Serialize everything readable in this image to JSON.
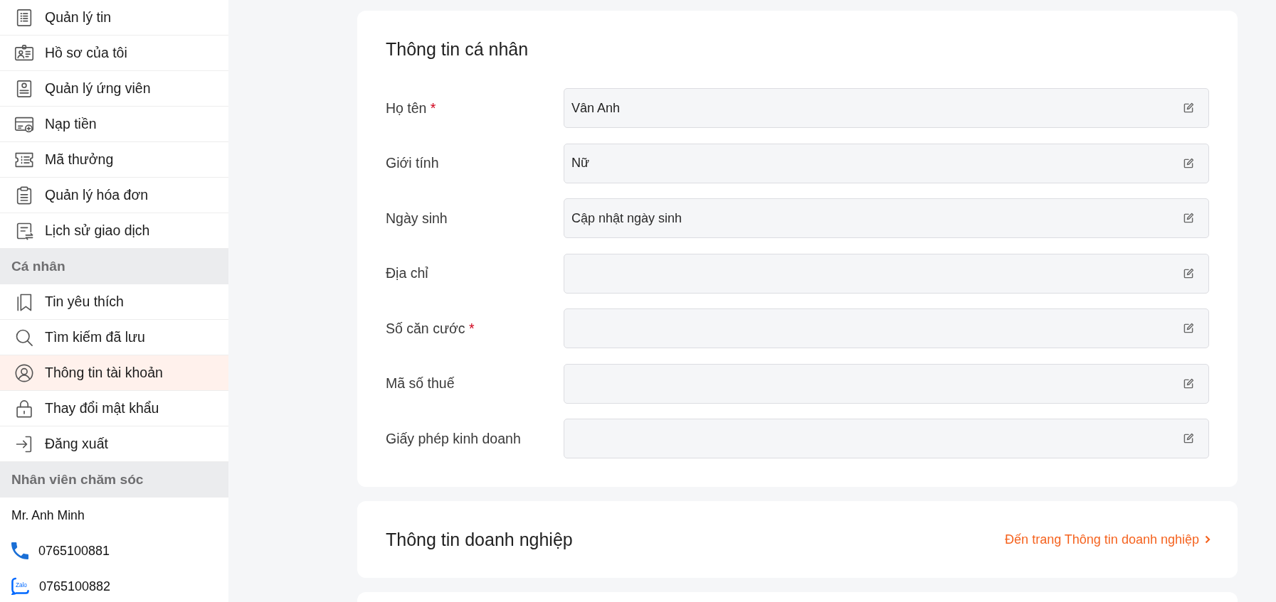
{
  "sidebar": {
    "sections": [
      {
        "items": [
          {
            "label": "Quản lý tin",
            "selected": false
          },
          {
            "label": "Hồ sơ của tôi",
            "selected": false
          },
          {
            "label": "Quản lý ứng viên",
            "selected": false
          },
          {
            "label": "Nạp tiền",
            "selected": false
          },
          {
            "label": "Mã thưởng",
            "selected": false
          },
          {
            "label": "Quản lý hóa đơn",
            "selected": false
          },
          {
            "label": "Lịch sử giao dịch",
            "selected": false
          }
        ]
      },
      {
        "title": "Cá nhân",
        "items": [
          {
            "label": "Tin yêu thích",
            "selected": false
          },
          {
            "label": "Tìm kiếm đã lưu",
            "selected": false
          },
          {
            "label": "Thông tin tài khoản",
            "selected": true
          },
          {
            "label": "Thay đổi mật khẩu",
            "selected": false
          },
          {
            "label": "Đăng xuất",
            "selected": false
          }
        ]
      }
    ],
    "support": {
      "title": "Nhân viên chăm sóc",
      "name": "Mr. Anh Minh",
      "contacts": [
        {
          "kind": "phone",
          "number": "0765100881"
        },
        {
          "kind": "chat",
          "logo_text": "Zalo",
          "number": "0765100882"
        }
      ]
    }
  },
  "personal_info": {
    "title": "Thông tin cá nhân",
    "fields": [
      {
        "label": "Họ tên",
        "required_mark": "*",
        "value": "Vân Anh"
      },
      {
        "label": "Giới tính",
        "value": "Nữ"
      },
      {
        "label": "Ngày sinh",
        "placeholder": "Cập nhật ngày sinh"
      },
      {
        "label": "Địa chỉ"
      },
      {
        "label": "Số căn cước",
        "required_mark": "*"
      },
      {
        "label": "Mã số thuế"
      },
      {
        "label": "Giấy phép kinh doanh"
      }
    ]
  },
  "business_info": {
    "title": "Thông tin doanh nghiệp",
    "link": "Đến trang Thông tin doanh nghiệp"
  }
}
